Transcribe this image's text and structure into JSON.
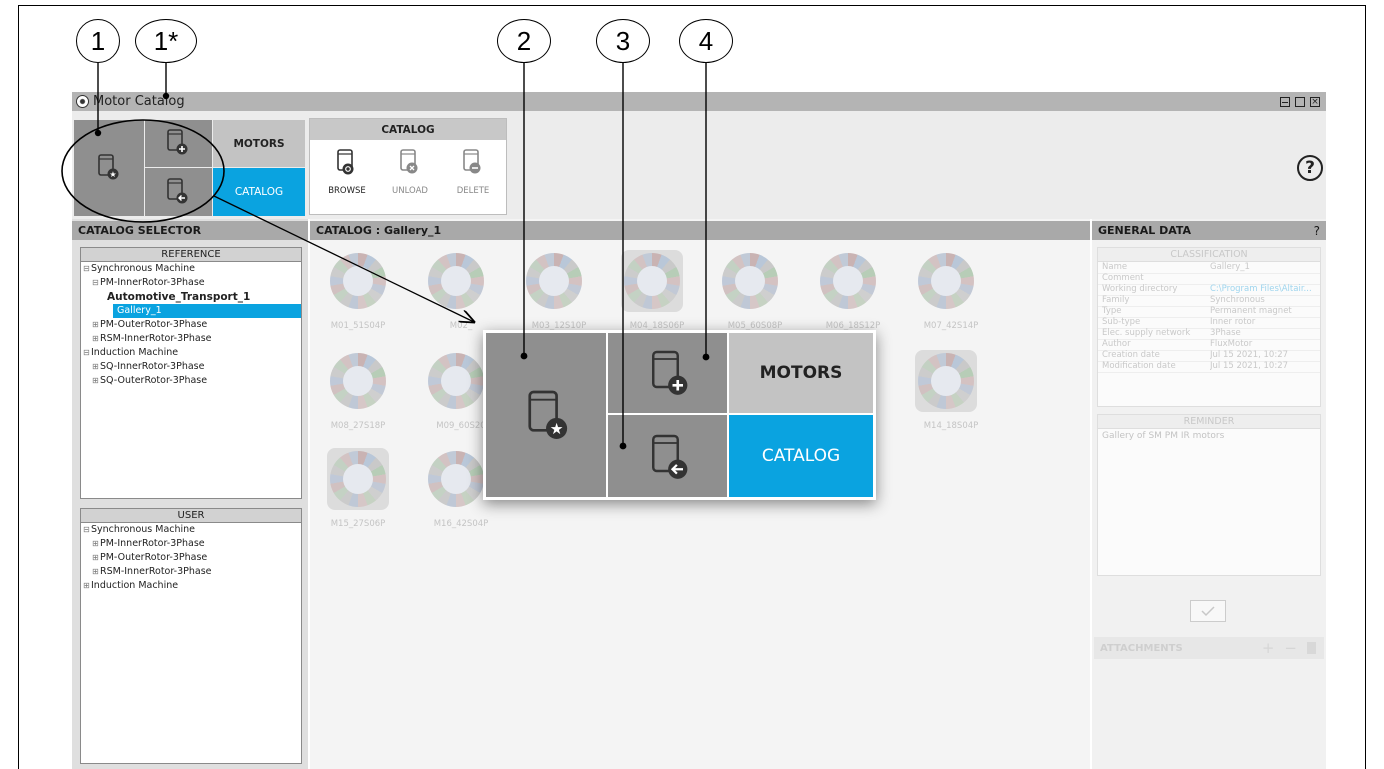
{
  "callouts": [
    "1",
    "1*",
    "2",
    "3",
    "4"
  ],
  "window": {
    "title": "Motor Catalog",
    "title_icon": "motor-gear-icon",
    "controls": [
      "minimize-icon",
      "maximize-icon",
      "close-icon"
    ]
  },
  "ribbon": {
    "motors_label": "MOTORS",
    "catalog_label": "CATALOG",
    "group_title": "CATALOG",
    "group_buttons": [
      {
        "label": "BROWSE",
        "icon": "browse-book-icon"
      },
      {
        "label": "UNLOAD",
        "icon": "unload-book-icon"
      },
      {
        "label": "DELETE",
        "icon": "delete-book-icon"
      }
    ],
    "help_icon": "help-icon",
    "help_symbol": "?",
    "accent": "#0aa3e0"
  },
  "selector": {
    "title": "CATALOG SELECTOR",
    "reference_title": "REFERENCE",
    "reference_items": [
      {
        "label": "Synchronous Machine",
        "level": 0,
        "exp": "⊟"
      },
      {
        "label": "PM-InnerRotor-3Phase",
        "level": 1,
        "exp": "⊟"
      },
      {
        "label": "Automotive_Transport_1",
        "level": 2,
        "exp": "",
        "bold": true
      },
      {
        "label": "Gallery_1",
        "level": 2,
        "exp": "",
        "selected": true
      },
      {
        "label": "PM-OuterRotor-3Phase",
        "level": 1,
        "exp": "⊞"
      },
      {
        "label": "RSM-InnerRotor-3Phase",
        "level": 1,
        "exp": "⊞"
      },
      {
        "label": "Induction Machine",
        "level": 0,
        "exp": "⊟"
      },
      {
        "label": "SQ-InnerRotor-3Phase",
        "level": 1,
        "exp": "⊞"
      },
      {
        "label": "SQ-OuterRotor-3Phase",
        "level": 1,
        "exp": "⊞"
      }
    ],
    "user_title": "USER",
    "user_items": [
      {
        "label": "Synchronous Machine",
        "level": 0,
        "exp": "⊟"
      },
      {
        "label": "PM-InnerRotor-3Phase",
        "level": 1,
        "exp": "⊞"
      },
      {
        "label": "PM-OuterRotor-3Phase",
        "level": 1,
        "exp": "⊞"
      },
      {
        "label": "RSM-InnerRotor-3Phase",
        "level": 1,
        "exp": "⊞"
      },
      {
        "label": "Induction Machine",
        "level": 0,
        "exp": "⊞"
      }
    ]
  },
  "catalog": {
    "title": "CATALOG : Gallery_1",
    "motors": [
      "M01_51S04P",
      "M02_",
      "M03_12S10P",
      "M04_18S06P",
      "M05_60S08P",
      "M06_18S12P",
      "M07_42S14P",
      "M08_27S18P",
      "M09_60S20",
      "M14_18S04P",
      "M15_27S06P",
      "M16_42S04P"
    ],
    "partial_labels": [
      "4P",
      "M03_12S10P",
      "M04_18S06P",
      "M05_60S08P",
      "M06_18S12P"
    ]
  },
  "general_data": {
    "title": "GENERAL DATA",
    "help_symbol": "?",
    "classification_title": "CLASSIFICATION",
    "rows": [
      {
        "key": "Name",
        "value": "Gallery_1"
      },
      {
        "key": "Comment",
        "value": ""
      },
      {
        "key": "Working directory",
        "value": "C:\\Program Files\\Altair..."
      },
      {
        "key": "Family",
        "value": "Synchronous"
      },
      {
        "key": "Type",
        "value": "Permanent magnet"
      },
      {
        "key": "Sub-type",
        "value": "Inner rotor"
      },
      {
        "key": "Elec. supply network",
        "value": "3Phase"
      },
      {
        "key": "Author",
        "value": "FluxMotor"
      },
      {
        "key": "Creation date",
        "value": "Jul 15 2021, 10:27"
      },
      {
        "key": "Modification date",
        "value": "Jul 15 2021, 10:27"
      }
    ],
    "reminder_title": "REMINDER",
    "reminder_text": "Gallery of SM PM IR motors",
    "validate_icon": "check-icon",
    "attachments_title": "ATTACHMENTS",
    "attachment_icons": [
      "add-icon",
      "remove-icon",
      "trash-icon"
    ]
  },
  "zoom": {
    "motors_label": "MOTORS",
    "catalog_label": "CATALOG"
  }
}
